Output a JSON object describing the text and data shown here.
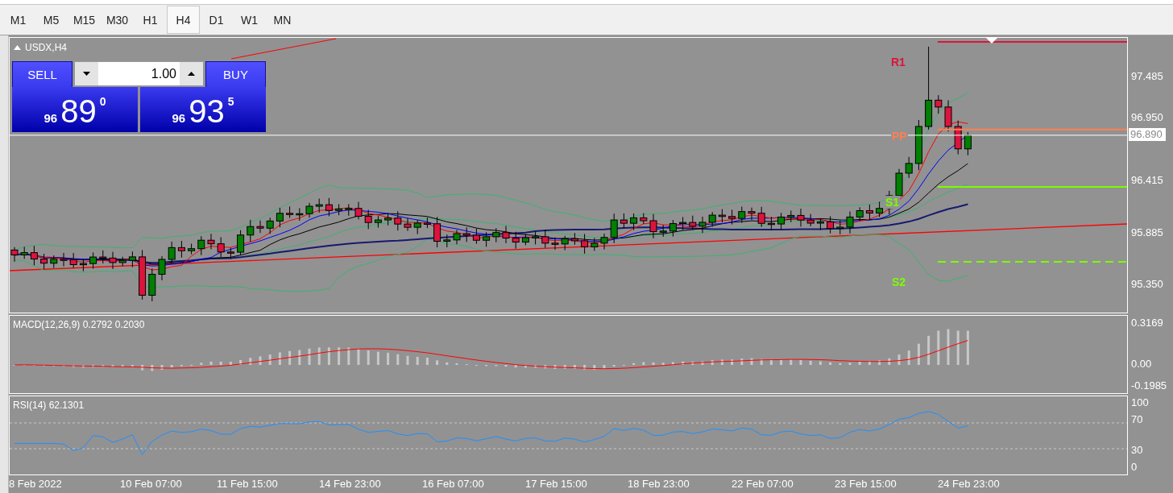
{
  "toolbar": {
    "timeframes": [
      {
        "label": "M1",
        "selected": false
      },
      {
        "label": "M5",
        "selected": false
      },
      {
        "label": "M15",
        "selected": false
      },
      {
        "label": "M30",
        "selected": false
      },
      {
        "label": "H1",
        "selected": false
      },
      {
        "label": "H4",
        "selected": true
      },
      {
        "label": "D1",
        "selected": false
      },
      {
        "label": "W1",
        "selected": false
      },
      {
        "label": "MN",
        "selected": false
      }
    ]
  },
  "chart": {
    "title": "USDX,H4",
    "trade_panel": {
      "sell_label": "SELL",
      "buy_label": "BUY",
      "lot": "1.00",
      "sell_price": {
        "prefix": "96",
        "main": "89",
        "suffix": "0"
      },
      "buy_price": {
        "prefix": "96",
        "main": "93",
        "suffix": "5"
      }
    },
    "pivots": [
      {
        "label": "R1",
        "color": "#dc143c"
      },
      {
        "label": "PP",
        "color": "#ff7f50"
      },
      {
        "label": "S1",
        "color": "#7cfc00"
      },
      {
        "label": "S2",
        "color": "#7cfc00"
      }
    ],
    "price_axis": [
      "97.485",
      "96.950",
      "96.415",
      "95.885",
      "95.350"
    ],
    "current_price": "96.890"
  },
  "macd": {
    "label": "MACD(12,26,9) 0.2792 0.2030",
    "axis": [
      "0.3169",
      "0.00",
      "-0.1985"
    ]
  },
  "rsi": {
    "label": "RSI(14) 62.1301",
    "axis": [
      "100",
      "70",
      "30",
      "0"
    ]
  },
  "time_axis": [
    "8 Feb 2022",
    "10 Feb 07:00",
    "11 Feb 15:00",
    "14 Feb 23:00",
    "16 Feb 07:00",
    "17 Feb 15:00",
    "18 Feb 23:00",
    "22 Feb 07:00",
    "23 Feb 15:00",
    "24 Feb 23:00"
  ]
}
